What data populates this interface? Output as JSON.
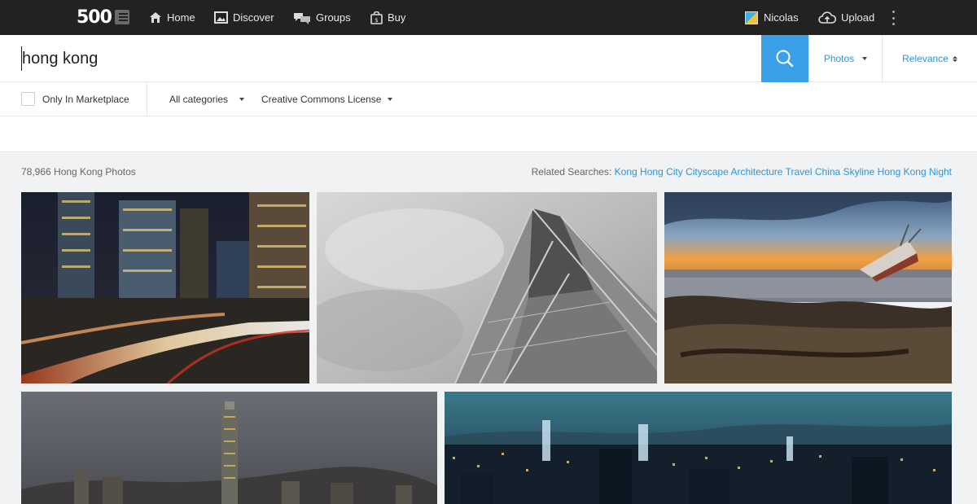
{
  "brand": {
    "logo": "500"
  },
  "nav": {
    "home": "Home",
    "discover": "Discover",
    "groups": "Groups",
    "buy": "Buy",
    "user": "Nicolas",
    "upload": "Upload"
  },
  "search": {
    "query": "hong kong",
    "type_label": "Photos",
    "sort_label": "Relevance"
  },
  "filters": {
    "marketplace_label": "Only In Marketplace",
    "categories_label": "All categories",
    "license_label": "Creative Commons License"
  },
  "results": {
    "count_text": "78,966 Hong Kong Photos",
    "related_label": "Related Searches:",
    "related": [
      "Kong",
      "Hong",
      "City",
      "Cityscape",
      "Architecture",
      "Travel",
      "China",
      "Skyline",
      "Hong Kong",
      "Night"
    ]
  },
  "icons": {
    "home": "home-icon",
    "discover": "picture-icon",
    "groups": "chat-bubbles-icon",
    "buy": "shopping-bag-icon",
    "upload": "cloud-upload-icon",
    "search": "search-icon",
    "more": "more-vertical-icon"
  },
  "colors": {
    "topbar": "#222222",
    "accent": "#3aa0e8",
    "link": "#2f93d8"
  }
}
